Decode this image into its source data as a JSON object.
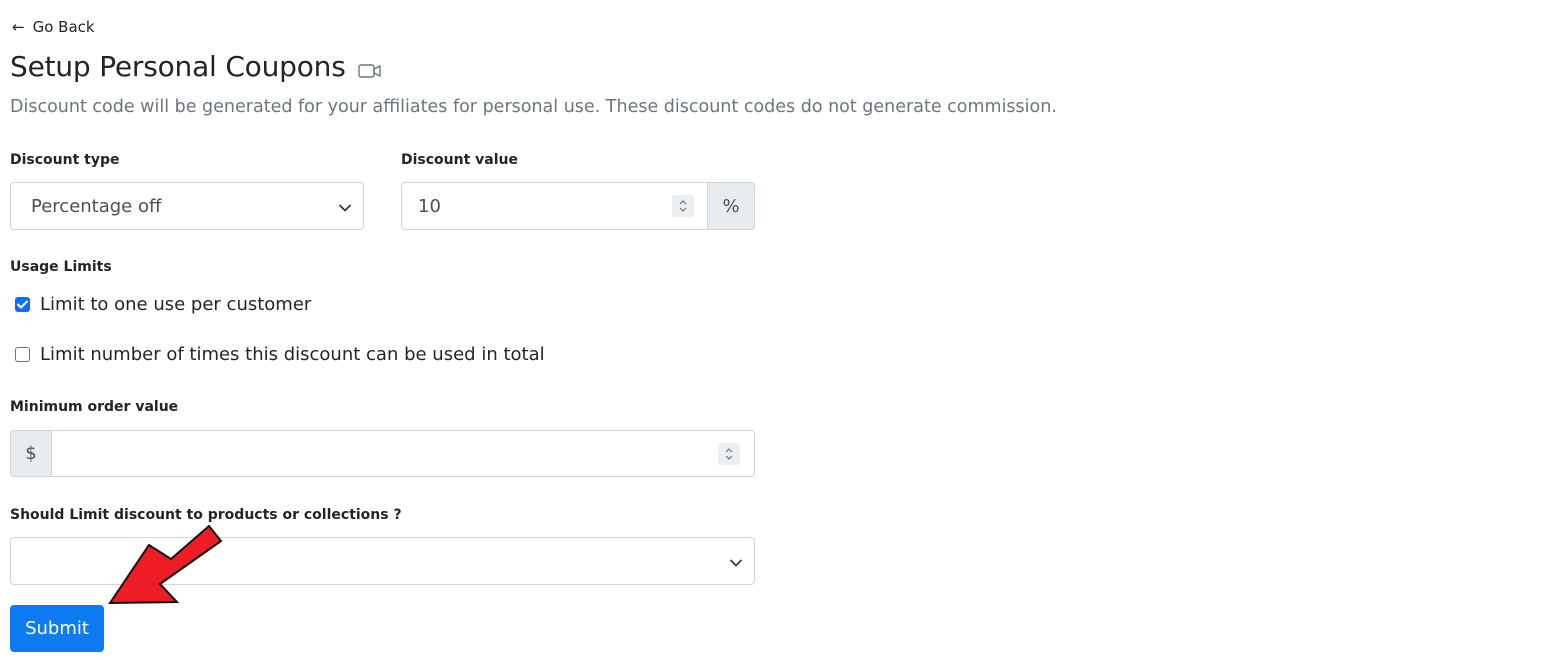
{
  "nav": {
    "back_label": "Go Back"
  },
  "page": {
    "title": "Setup Personal Coupons",
    "description": "Discount code will be generated for your affiliates for personal use. These discount codes do not generate commission."
  },
  "discount_type": {
    "label": "Discount type",
    "value": "Percentage off"
  },
  "discount_value": {
    "label": "Discount value",
    "value": "10",
    "suffix": "%"
  },
  "usage_limits": {
    "label": "Usage Limits",
    "options": [
      {
        "label": "Limit to one use per customer",
        "checked": true
      },
      {
        "label": "Limit number of times this discount can be used in total",
        "checked": false
      }
    ]
  },
  "min_order": {
    "label": "Minimum order value",
    "prefix": "$",
    "value": ""
  },
  "limit_products": {
    "label": "Should Limit discount to products or collections ?",
    "value": ""
  },
  "submit": {
    "label": "Submit"
  },
  "colors": {
    "primary": "#0d7cf2",
    "annotation_arrow": "#ee1c24"
  },
  "icons": [
    "left-arrow-icon",
    "video-camera-icon",
    "chevron-down-icon",
    "spinner-icon",
    "checkmark-icon",
    "annotation-arrow-icon"
  ]
}
